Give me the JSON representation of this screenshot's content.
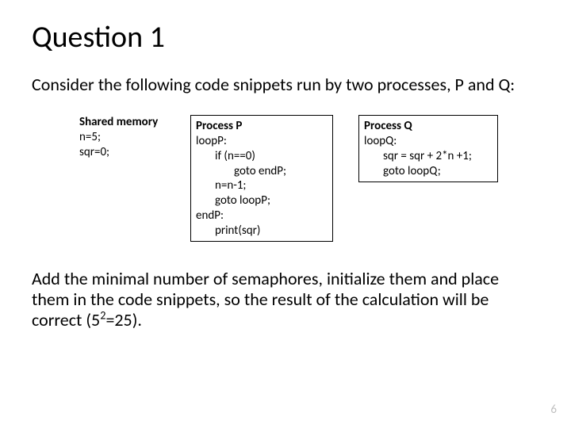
{
  "title": "Question 1",
  "intro": "Consider the following code snippets run by two processes, P and Q:",
  "shared": {
    "heading": "Shared memory",
    "l1": "n=5;",
    "l2": "sqr=0;"
  },
  "procP": {
    "heading": "Process P",
    "l1": "loopP:",
    "l2": "if (n==0)",
    "l3": "goto endP;",
    "l4": "n=n-1;",
    "l5": "goto loopP;",
    "l6": "endP:",
    "l7": "print(sqr)"
  },
  "procQ": {
    "heading": "Process Q",
    "l1": "loopQ:",
    "l2": "sqr = sqr + 2*n +1;",
    "l3": "goto loopQ;"
  },
  "closing_pre": "Add the minimal number of semaphores, initialize them and place them in the code snippets, so the result of the calculation will be correct (5",
  "closing_sup": "2",
  "closing_post": "=25).",
  "page": "6"
}
